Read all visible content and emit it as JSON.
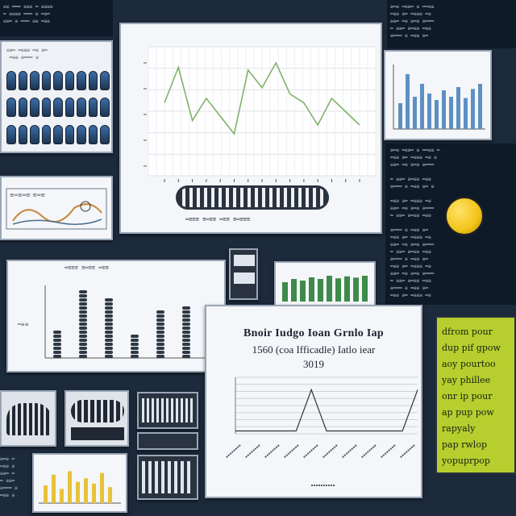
{
  "center_chart": {
    "title": "",
    "type": "line",
    "y_ticks": [
      "",
      "",
      "",
      "",
      ""
    ],
    "series_points": [
      0.55,
      0.95,
      0.35,
      0.6,
      0.4,
      0.2,
      0.92,
      0.72,
      1.0,
      0.65,
      0.55,
      0.3,
      0.6,
      0.45,
      0.3
    ],
    "line_color": "#7fb36a"
  },
  "card_chart": {
    "title_line1": "Bnoir Iudgo  Ioan Grnlo Iap",
    "title_line2": "1560 (coa Ifficadle) Iatlo iear",
    "title_line3": "3019",
    "type": "line",
    "series_points": [
      0.05,
      0.05,
      0.05,
      0.05,
      0.05,
      0.78,
      0.05,
      0.05,
      0.05,
      0.05,
      0.05,
      0.05,
      0.78
    ]
  },
  "left_bar_chart": {
    "type": "bar",
    "values": [
      0.35,
      0.9,
      0.8,
      0.3,
      0.65,
      0.7
    ]
  },
  "top_right_bar_chart": {
    "type": "bar",
    "values": [
      0.4,
      0.85,
      0.5,
      0.7,
      0.55,
      0.45,
      0.6,
      0.5,
      0.65,
      0.48,
      0.62,
      0.7
    ],
    "bar_color": "#5e8fc4"
  },
  "green_bar_chart": {
    "type": "bar",
    "values": [
      0.6,
      0.7,
      0.65,
      0.75,
      0.7,
      0.8,
      0.72,
      0.78,
      0.74,
      0.8
    ],
    "bar_color": "#3f8a4a"
  },
  "yellow_bar_chart": {
    "type": "bar",
    "values": [
      0.5,
      0.8,
      0.4,
      0.9,
      0.6,
      0.7,
      0.55,
      0.85,
      0.45
    ],
    "bar_color": "#e8c23a"
  },
  "sticky_note": {
    "lines": [
      "dfrom pour",
      "dup pif gpow",
      "aoy pourtoo",
      "yay phillee",
      "onr ip pour",
      "ap pup pow",
      "rapyaly",
      "pap rwlop",
      "yopuprpop"
    ],
    "color": "#b6cf2e"
  },
  "accent": {
    "yellow": "#f2c418",
    "panel": "#0f1a28",
    "bg": "#1d2a3b"
  }
}
